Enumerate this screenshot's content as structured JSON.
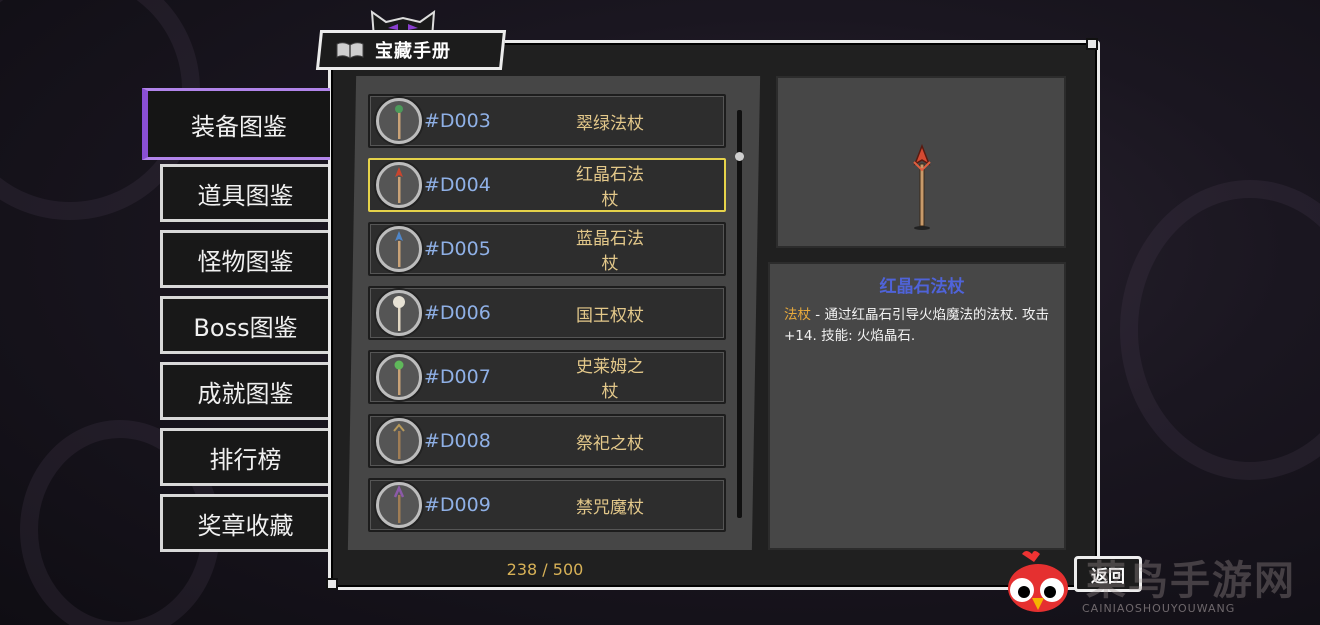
{
  "title": "宝藏手册",
  "tabs": [
    "装备图鉴",
    "道具图鉴",
    "怪物图鉴",
    "Boss图鉴",
    "成就图鉴",
    "排行榜",
    "奖章收藏"
  ],
  "items": [
    {
      "code": "#D003",
      "name": "翠绿法杖",
      "gem": "#4c9a5a"
    },
    {
      "code": "#D004",
      "name": "红晶石法杖",
      "gem": "#c8452e"
    },
    {
      "code": "#D005",
      "name": "蓝晶石法杖",
      "gem": "#4f86c9"
    },
    {
      "code": "#D006",
      "name": "国王权杖",
      "gem": "#e6e1d4"
    },
    {
      "code": "#D007",
      "name": "史莱姆之杖",
      "gem": "#5fb85a"
    },
    {
      "code": "#D008",
      "name": "祭祀之杖",
      "gem": "#b89a5a"
    },
    {
      "code": "#D009",
      "name": "禁咒魔杖",
      "gem": "#8c5aa8"
    }
  ],
  "counter": "238 / 500",
  "detail": {
    "title": "红晶石法杖",
    "type": "法杖",
    "description": " - 通过红晶石引导火焰魔法的法杖. 攻击+14. 技能: 火焰晶石."
  },
  "back_label": "返回",
  "watermark": "菜鸟手游网",
  "watermark_sub": "CAINIAOSHOUYOUWANG"
}
